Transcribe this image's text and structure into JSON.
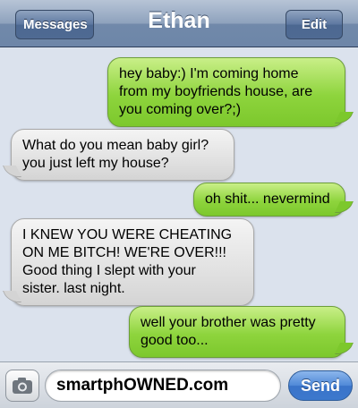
{
  "header": {
    "title": "Ethan",
    "back_label": "Messages",
    "edit_label": "Edit"
  },
  "messages": [
    {
      "direction": "sent",
      "lines": [
        "hey baby:) I'm coming home",
        "from my boyfriends house, are",
        "you coming over?;)"
      ]
    },
    {
      "direction": "received",
      "lines": [
        "What do you mean baby girl?",
        "you just left my house?"
      ]
    },
    {
      "direction": "sent",
      "lines": [
        "oh shit... nevermind"
      ]
    },
    {
      "direction": "received",
      "lines": [
        "I KNEW YOU WERE CHEATING",
        "ON ME BITCH! WE'RE OVER!!!",
        "Good thing I slept with your",
        "sister. last night."
      ]
    },
    {
      "direction": "sent",
      "lines": [
        "well your brother was pretty",
        "good too..."
      ]
    }
  ],
  "input": {
    "value": "smartphOWNED.com",
    "send_label": "Send",
    "camera_icon": "camera-icon"
  },
  "colors": {
    "sent_bubble": "#8ed43d",
    "received_bubble": "#e3e3e3",
    "navbar": "#7189aa",
    "send_button": "#4f89d8"
  }
}
